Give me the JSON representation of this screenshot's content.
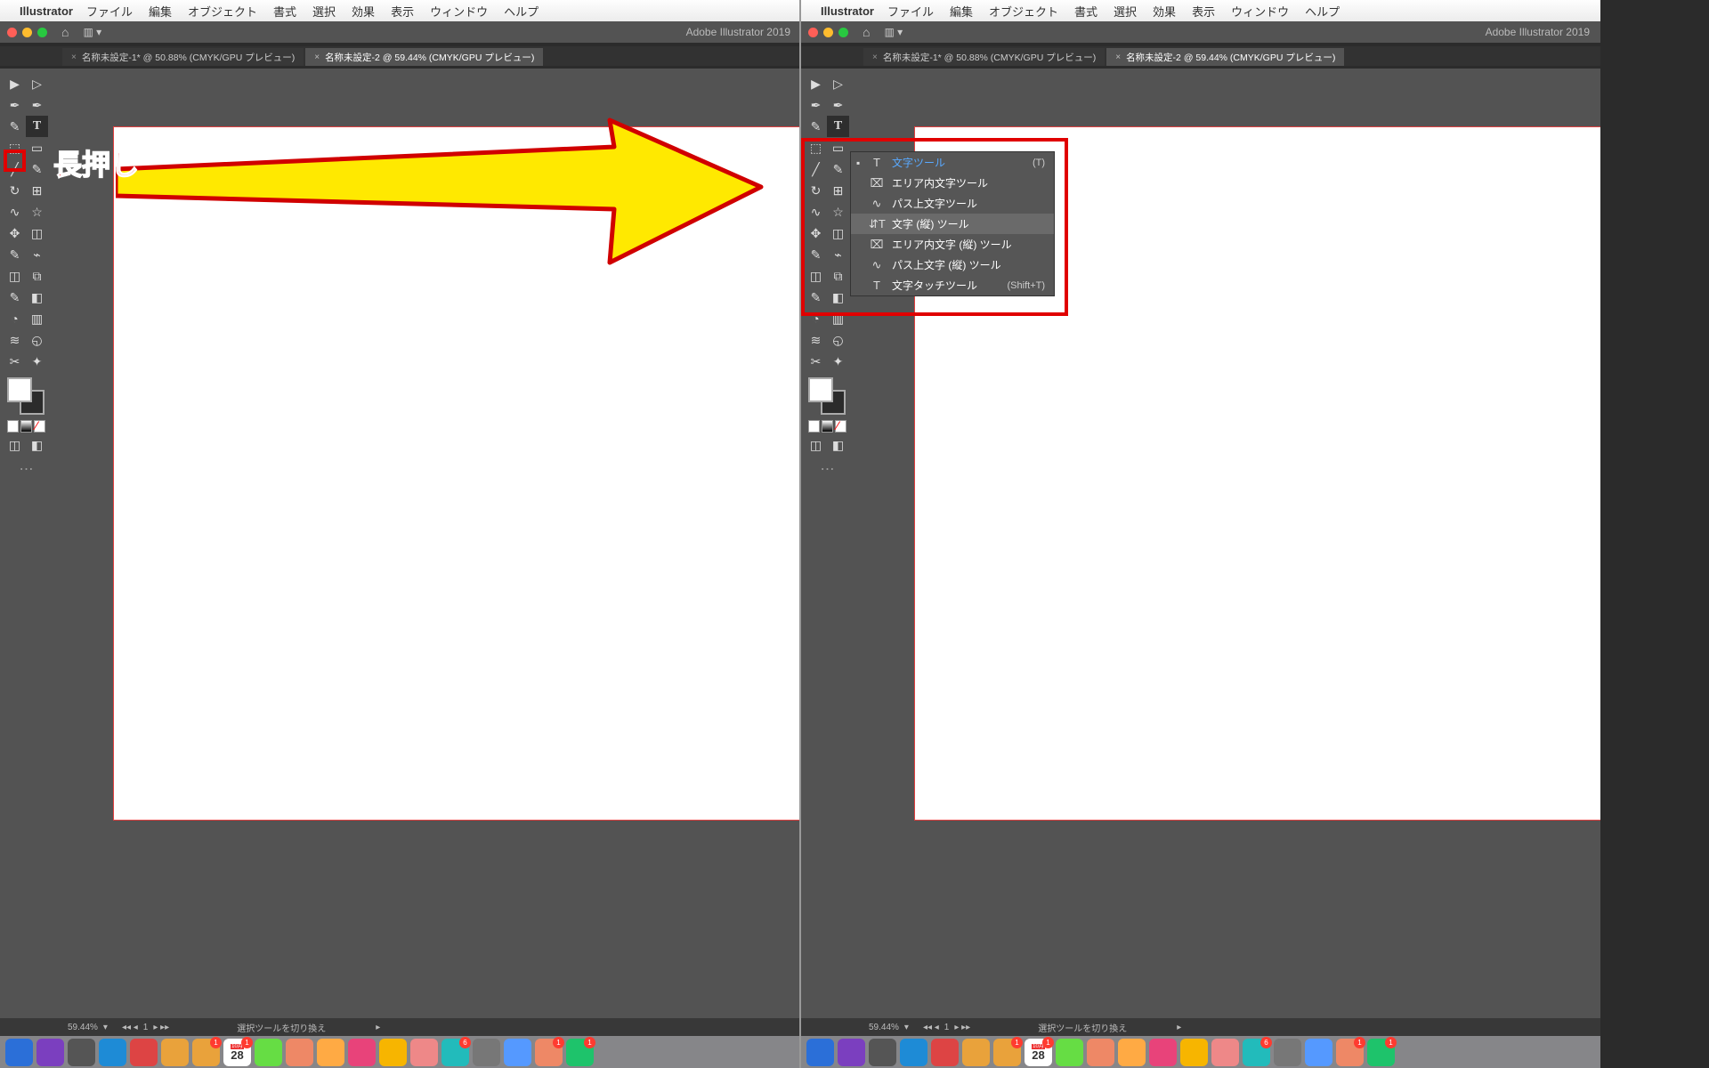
{
  "menus": [
    "ファイル",
    "編集",
    "オブジェクト",
    "書式",
    "選択",
    "効果",
    "表示",
    "ウィンドウ",
    "ヘルプ"
  ],
  "appname": "Illustrator",
  "apptitle": "Adobe Illustrator 2019",
  "traffic": [
    "#ff5f57",
    "#febc2e",
    "#28c840"
  ],
  "tabs": [
    {
      "label": "名称未設定-1* @ 50.88% (CMYK/GPU プレビュー)",
      "active": false
    },
    {
      "label": "名称未設定-2 @ 59.44% (CMYK/GPU プレビュー)",
      "active": true
    }
  ],
  "callout": "長押し",
  "flyout": [
    {
      "label": "文字ツール",
      "shortcut": "(T)",
      "active": true
    },
    {
      "label": "エリア内文字ツール"
    },
    {
      "label": "パス上文字ツール"
    },
    {
      "label": "文字 (縦) ツール",
      "hover": true
    },
    {
      "label": "エリア内文字 (縦) ツール"
    },
    {
      "label": "パス上文字 (縦) ツール"
    },
    {
      "label": "文字タッチツール",
      "shortcut": "(Shift+T)"
    }
  ],
  "status": {
    "zoom": "59.44%",
    "artboard": "1",
    "hint": "選択ツールを切り換え"
  },
  "dock_colors": [
    "#2b6fd8",
    "#7b3fbf",
    "#555",
    "#1e8bd6",
    "#d44",
    "#e9a23b",
    "#e9a23b",
    "#4a90e2",
    "#6d4",
    "#e86",
    "#fa4",
    "#e8437a",
    "#f7b500",
    "#e88",
    "#2bb",
    "#777",
    "#59f",
    "#e86",
    "#1ec36b"
  ],
  "dock_badges": {
    "6": "1",
    "7": "1",
    "14": "6",
    "17": "1",
    "18": "1"
  },
  "calendar_day": "28"
}
